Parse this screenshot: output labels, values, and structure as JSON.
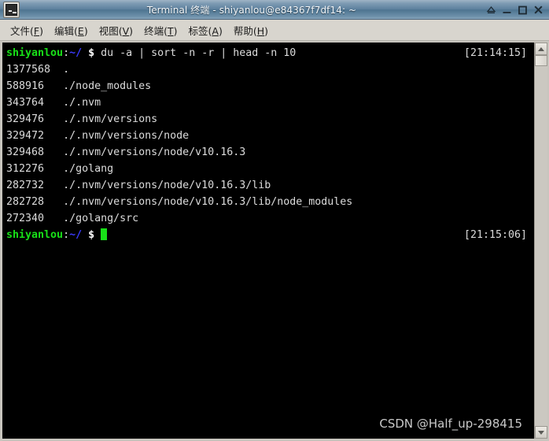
{
  "window": {
    "title": "Terminal 终端 - shiyanlou@e84367f7df14: ~",
    "icon": "terminal-icon",
    "controls": [
      {
        "name": "shade-button",
        "label": "▲"
      },
      {
        "name": "minimize-button",
        "label": "_"
      },
      {
        "name": "maximize-button",
        "label": "□"
      },
      {
        "name": "close-button",
        "label": "✕"
      }
    ]
  },
  "menubar": {
    "items": [
      {
        "label": "文件",
        "mnemonic": "F",
        "name": "menu-file"
      },
      {
        "label": "编辑",
        "mnemonic": "E",
        "name": "menu-edit"
      },
      {
        "label": "视图",
        "mnemonic": "V",
        "name": "menu-view"
      },
      {
        "label": "终端",
        "mnemonic": "T",
        "name": "menu-terminal"
      },
      {
        "label": "标签",
        "mnemonic": "A",
        "name": "menu-tabs"
      },
      {
        "label": "帮助",
        "mnemonic": "H",
        "name": "menu-help"
      }
    ]
  },
  "terminal": {
    "prompt": {
      "user": "shiyanlou",
      "colon": ":",
      "path": "~/",
      "sigil": "$"
    },
    "command": "du -a | sort -n -r | head -n 10",
    "command_timestamp": "[21:14:15]",
    "output": [
      {
        "size": "1377568",
        "path": "."
      },
      {
        "size": "588916",
        "path": "./node_modules"
      },
      {
        "size": "343764",
        "path": "./.nvm"
      },
      {
        "size": "329476",
        "path": "./.nvm/versions"
      },
      {
        "size": "329472",
        "path": "./.nvm/versions/node"
      },
      {
        "size": "329468",
        "path": "./.nvm/versions/node/v10.16.3"
      },
      {
        "size": "312276",
        "path": "./golang"
      },
      {
        "size": "282732",
        "path": "./.nvm/versions/node/v10.16.3/lib"
      },
      {
        "size": "282728",
        "path": "./.nvm/versions/node/v10.16.3/lib/node_modules"
      },
      {
        "size": "272340",
        "path": "./golang/src"
      }
    ],
    "final_timestamp": "[21:15:06]",
    "watermark": "CSDN @Half_up-298415",
    "colors": {
      "background": "#000000",
      "foreground": "#d9d9d9",
      "prompt_user": "#18e018",
      "prompt_path": "#3b3bff",
      "cursor": "#18e018"
    }
  },
  "scrollbar": {
    "up_arrow": "scroll-up-arrow",
    "down_arrow": "scroll-down-arrow"
  }
}
